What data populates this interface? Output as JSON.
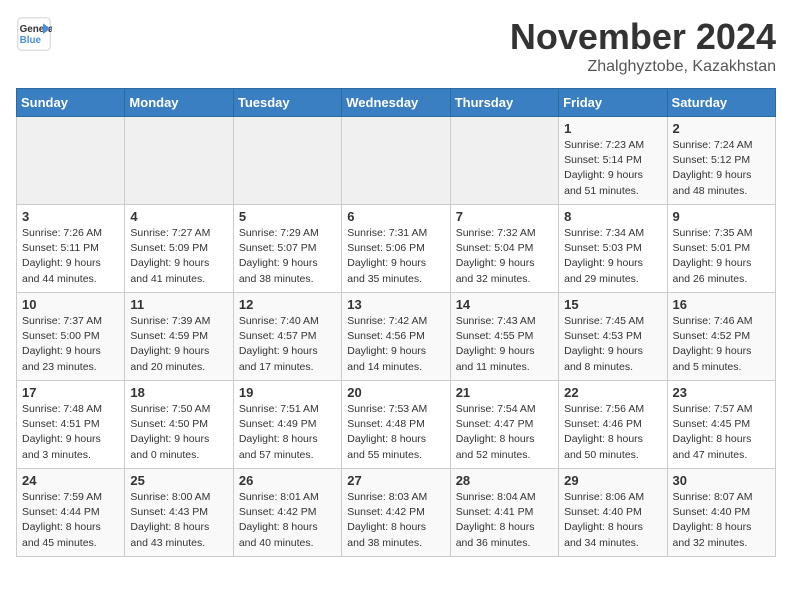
{
  "header": {
    "logo_line1": "General",
    "logo_line2": "Blue",
    "month": "November 2024",
    "location": "Zhalghyztobe, Kazakhstan"
  },
  "days_of_week": [
    "Sunday",
    "Monday",
    "Tuesday",
    "Wednesday",
    "Thursday",
    "Friday",
    "Saturday"
  ],
  "weeks": [
    [
      {
        "num": "",
        "info": ""
      },
      {
        "num": "",
        "info": ""
      },
      {
        "num": "",
        "info": ""
      },
      {
        "num": "",
        "info": ""
      },
      {
        "num": "",
        "info": ""
      },
      {
        "num": "1",
        "info": "Sunrise: 7:23 AM\nSunset: 5:14 PM\nDaylight: 9 hours\nand 51 minutes."
      },
      {
        "num": "2",
        "info": "Sunrise: 7:24 AM\nSunset: 5:12 PM\nDaylight: 9 hours\nand 48 minutes."
      }
    ],
    [
      {
        "num": "3",
        "info": "Sunrise: 7:26 AM\nSunset: 5:11 PM\nDaylight: 9 hours\nand 44 minutes."
      },
      {
        "num": "4",
        "info": "Sunrise: 7:27 AM\nSunset: 5:09 PM\nDaylight: 9 hours\nand 41 minutes."
      },
      {
        "num": "5",
        "info": "Sunrise: 7:29 AM\nSunset: 5:07 PM\nDaylight: 9 hours\nand 38 minutes."
      },
      {
        "num": "6",
        "info": "Sunrise: 7:31 AM\nSunset: 5:06 PM\nDaylight: 9 hours\nand 35 minutes."
      },
      {
        "num": "7",
        "info": "Sunrise: 7:32 AM\nSunset: 5:04 PM\nDaylight: 9 hours\nand 32 minutes."
      },
      {
        "num": "8",
        "info": "Sunrise: 7:34 AM\nSunset: 5:03 PM\nDaylight: 9 hours\nand 29 minutes."
      },
      {
        "num": "9",
        "info": "Sunrise: 7:35 AM\nSunset: 5:01 PM\nDaylight: 9 hours\nand 26 minutes."
      }
    ],
    [
      {
        "num": "10",
        "info": "Sunrise: 7:37 AM\nSunset: 5:00 PM\nDaylight: 9 hours\nand 23 minutes."
      },
      {
        "num": "11",
        "info": "Sunrise: 7:39 AM\nSunset: 4:59 PM\nDaylight: 9 hours\nand 20 minutes."
      },
      {
        "num": "12",
        "info": "Sunrise: 7:40 AM\nSunset: 4:57 PM\nDaylight: 9 hours\nand 17 minutes."
      },
      {
        "num": "13",
        "info": "Sunrise: 7:42 AM\nSunset: 4:56 PM\nDaylight: 9 hours\nand 14 minutes."
      },
      {
        "num": "14",
        "info": "Sunrise: 7:43 AM\nSunset: 4:55 PM\nDaylight: 9 hours\nand 11 minutes."
      },
      {
        "num": "15",
        "info": "Sunrise: 7:45 AM\nSunset: 4:53 PM\nDaylight: 9 hours\nand 8 minutes."
      },
      {
        "num": "16",
        "info": "Sunrise: 7:46 AM\nSunset: 4:52 PM\nDaylight: 9 hours\nand 5 minutes."
      }
    ],
    [
      {
        "num": "17",
        "info": "Sunrise: 7:48 AM\nSunset: 4:51 PM\nDaylight: 9 hours\nand 3 minutes."
      },
      {
        "num": "18",
        "info": "Sunrise: 7:50 AM\nSunset: 4:50 PM\nDaylight: 9 hours\nand 0 minutes."
      },
      {
        "num": "19",
        "info": "Sunrise: 7:51 AM\nSunset: 4:49 PM\nDaylight: 8 hours\nand 57 minutes."
      },
      {
        "num": "20",
        "info": "Sunrise: 7:53 AM\nSunset: 4:48 PM\nDaylight: 8 hours\nand 55 minutes."
      },
      {
        "num": "21",
        "info": "Sunrise: 7:54 AM\nSunset: 4:47 PM\nDaylight: 8 hours\nand 52 minutes."
      },
      {
        "num": "22",
        "info": "Sunrise: 7:56 AM\nSunset: 4:46 PM\nDaylight: 8 hours\nand 50 minutes."
      },
      {
        "num": "23",
        "info": "Sunrise: 7:57 AM\nSunset: 4:45 PM\nDaylight: 8 hours\nand 47 minutes."
      }
    ],
    [
      {
        "num": "24",
        "info": "Sunrise: 7:59 AM\nSunset: 4:44 PM\nDaylight: 8 hours\nand 45 minutes."
      },
      {
        "num": "25",
        "info": "Sunrise: 8:00 AM\nSunset: 4:43 PM\nDaylight: 8 hours\nand 43 minutes."
      },
      {
        "num": "26",
        "info": "Sunrise: 8:01 AM\nSunset: 4:42 PM\nDaylight: 8 hours\nand 40 minutes."
      },
      {
        "num": "27",
        "info": "Sunrise: 8:03 AM\nSunset: 4:42 PM\nDaylight: 8 hours\nand 38 minutes."
      },
      {
        "num": "28",
        "info": "Sunrise: 8:04 AM\nSunset: 4:41 PM\nDaylight: 8 hours\nand 36 minutes."
      },
      {
        "num": "29",
        "info": "Sunrise: 8:06 AM\nSunset: 4:40 PM\nDaylight: 8 hours\nand 34 minutes."
      },
      {
        "num": "30",
        "info": "Sunrise: 8:07 AM\nSunset: 4:40 PM\nDaylight: 8 hours\nand 32 minutes."
      }
    ]
  ]
}
